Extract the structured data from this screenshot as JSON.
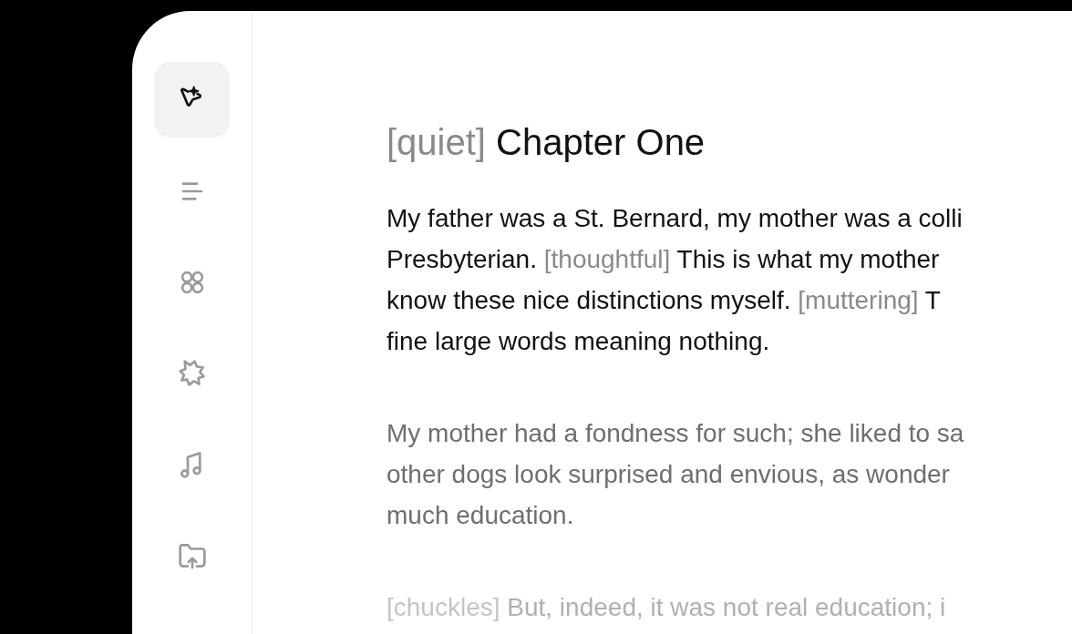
{
  "sidebar": {
    "items": [
      {
        "selected": true
      },
      {
        "selected": false
      },
      {
        "selected": false
      },
      {
        "selected": false
      },
      {
        "selected": false
      },
      {
        "selected": false
      }
    ]
  },
  "document": {
    "heading": {
      "tag": "[quiet]",
      "title": "Chapter One"
    },
    "paragraphs": [
      {
        "kind": "primary",
        "lines": [
          [
            {
              "kind": "text",
              "text": "My father was a St. Bernard, my mother was a colli"
            }
          ],
          [
            {
              "kind": "text",
              "text": "Presbyterian. "
            },
            {
              "kind": "tag",
              "text": "[thoughtful]"
            },
            {
              "kind": "text",
              "text": " This is what my mother"
            }
          ],
          [
            {
              "kind": "text",
              "text": "know these nice distinctions myself. "
            },
            {
              "kind": "tag",
              "text": "[muttering]"
            },
            {
              "kind": "text",
              "text": " T"
            }
          ],
          [
            {
              "kind": "text",
              "text": "fine large words meaning nothing."
            }
          ]
        ]
      },
      {
        "kind": "secondary",
        "lines": [
          [
            {
              "kind": "text",
              "text": "My mother had a fondness for such; she liked to sa"
            }
          ],
          [
            {
              "kind": "text",
              "text": "other dogs look surprised and envious, as wonder"
            }
          ],
          [
            {
              "kind": "text",
              "text": "much education."
            }
          ]
        ]
      },
      {
        "kind": "faded",
        "lines": [
          [
            {
              "kind": "tag",
              "text": "[chuckles]"
            },
            {
              "kind": "text",
              "text": " But, indeed, it was not real education; i"
            }
          ]
        ]
      }
    ]
  }
}
